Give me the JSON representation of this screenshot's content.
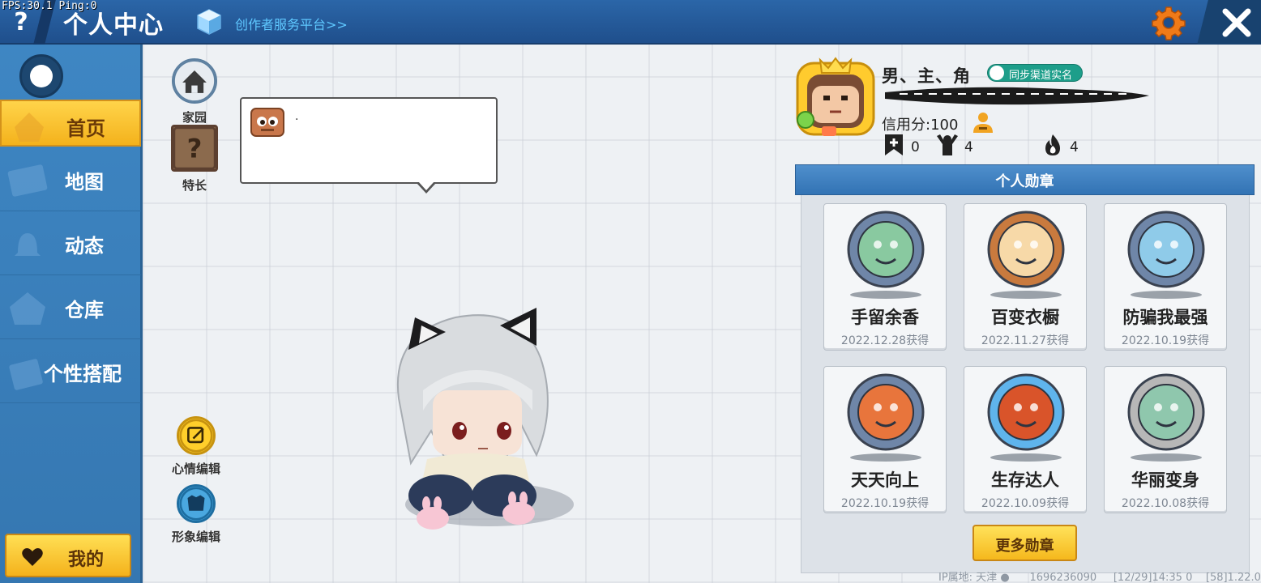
{
  "debug": {
    "fps_text": "FPS:30.1  Ping:0"
  },
  "header": {
    "title": "个人中心",
    "creator_link": "创作者服务平台>>",
    "help_label": "?"
  },
  "sidebar": {
    "items": [
      {
        "label": "首页",
        "icon": "cupcake-icon",
        "active": true
      },
      {
        "label": "地图",
        "icon": "map-icon",
        "active": false
      },
      {
        "label": "动态",
        "icon": "bell-icon",
        "active": false
      },
      {
        "label": "仓库",
        "icon": "house-icon",
        "active": false
      },
      {
        "label": "个性搭配",
        "icon": "block-icon",
        "active": false
      }
    ],
    "mine_label": "我的"
  },
  "tools": {
    "home_label": "家园",
    "talent_label": "特长",
    "mood_label": "心情编辑",
    "look_label": "形象编辑"
  },
  "bubble": {
    "text": "."
  },
  "profile": {
    "name": "男、主、角",
    "realname_label": "同步渠道实名",
    "credit_text": "信用分:100",
    "likes": "0",
    "fans": "4",
    "heat": "4"
  },
  "medals": {
    "header": "个人勋章",
    "items": [
      {
        "name": "手留余香",
        "date": "2022.12.28获得",
        "ring": "#6f86a8",
        "core": "#89c9a0"
      },
      {
        "name": "百变衣橱",
        "date": "2022.11.27获得",
        "ring": "#c97a3e",
        "core": "#f7d9a8"
      },
      {
        "name": "防骗我最强",
        "date": "2022.10.19获得",
        "ring": "#6f86a8",
        "core": "#8fcbe9"
      },
      {
        "name": "天天向上",
        "date": "2022.10.19获得",
        "ring": "#6f86a8",
        "core": "#e8753c"
      },
      {
        "name": "生存达人",
        "date": "2022.10.09获得",
        "ring": "#5fb4ec",
        "core": "#d9542a"
      },
      {
        "name": "华丽变身",
        "date": "2022.10.08获得",
        "ring": "#b7b7b7",
        "core": "#8fc7ad"
      }
    ],
    "more_label": "更多勋章"
  },
  "footer": {
    "ip_text": "IP属地: 天津",
    "uid": "1696236090",
    "time": "[12/29]14:35 0",
    "version": "[58]1.22.0"
  },
  "colors": {
    "topbar": "#2b66a8",
    "sidebar": "#3e86c3",
    "accent_yellow": "#f4b21c",
    "gear": "#f07a18"
  }
}
